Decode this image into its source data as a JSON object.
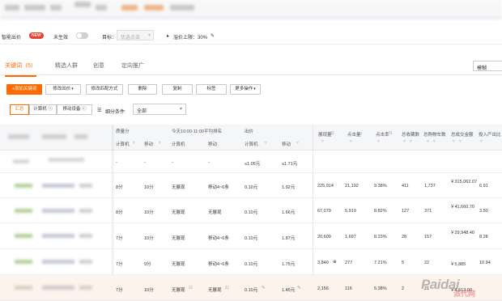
{
  "smart_row": {
    "smart_label": "智能出价",
    "new_badge": "NEW",
    "ineffective_label": "未生效",
    "target_label": "目标：",
    "target_placeholder": "优选点击",
    "ceiling_label": "溢价上限：30%",
    "pencil_icon": "✎"
  },
  "tabs": [
    {
      "label": "关键词（5）",
      "active": true
    },
    {
      "label": "精选人群",
      "active": false
    },
    {
      "label": "创意",
      "active": false
    },
    {
      "label": "定向推广",
      "active": false
    }
  ],
  "match_select": "模糊",
  "toolbar": {
    "add_keyword": "+添加关键词",
    "modify_bid": "修改出价",
    "modify_match": "修改匹配方式",
    "delete": "删除",
    "copy": "复制",
    "tag": "标签",
    "more": "更多操作"
  },
  "segments": {
    "summary": "汇总",
    "pc": "计算机",
    "mobile": "移动设备",
    "filter_label": "细分条件:",
    "filter_value": "全部"
  },
  "table": {
    "group_headers": {
      "quality": "质量分",
      "rank": "今天10:00-11:00平均排名",
      "bid": "出价",
      "impressions": "展现量",
      "clicks": "点击量",
      "ctr": "点击率",
      "total_fav": "总收藏数",
      "total_cart": "总购物车数",
      "total_trans": "总成交金额",
      "roi": "投入产出比"
    },
    "sub_headers": {
      "pc": "计算机",
      "mobile": "移动",
      "rank_pc": "计算机",
      "rank_mobile": "移动",
      "bid_pc": "计算机",
      "bid_mobile": "移动"
    },
    "rows": [
      {
        "q_pc": "-",
        "q_mob": "-",
        "r_pc": "-",
        "r_mob": "-",
        "b_pc": "≤1.05元",
        "b_mob": "≤1.71元",
        "imp": "",
        "clk": "",
        "ctr": "",
        "fav": "",
        "cart": "",
        "trans": "",
        "roi": ""
      },
      {
        "q_pc": "8分",
        "q_mob": "10分",
        "r_pc": "无展现",
        "r_mob": "移动4~6条",
        "b_pc": "0.10元",
        "b_mob": "1.92元",
        "imp": "225,914",
        "clk": "21,192",
        "ctr": "9.38%",
        "fav": "411",
        "cart": "1,737",
        "trans": "￥315,062.07",
        "roi": "6.91"
      },
      {
        "q_pc": "8分",
        "q_mob": "10分",
        "r_pc": "无展现",
        "r_mob": "无展现",
        "b_pc": "0.10元",
        "b_mob": "1.66元",
        "imp": "67,079",
        "clk": "5,919",
        "ctr": "8.82%",
        "fav": "127",
        "cart": "371",
        "trans": "￥41,660.70",
        "roi": "3.50"
      },
      {
        "q_pc": "7分",
        "q_mob": "10分",
        "r_pc": "无展现",
        "r_mob": "移动4~6条",
        "b_pc": "0.10元",
        "b_mob": "1.87元",
        "imp": "20,609",
        "clk": "1,697",
        "ctr": "8.23%",
        "fav": "28",
        "cart": "157",
        "trans": "￥29,948.40",
        "roi": "8.28"
      },
      {
        "q_pc": "7分",
        "q_mob": "9分",
        "r_pc": "无展现",
        "r_mob": "移动4~6条",
        "b_pc": "0.10元",
        "b_mob": "1.75元",
        "imp": "3,840",
        "clk": "277",
        "ctr": "7.21%",
        "fav": "5",
        "cart": "22",
        "trans": "￥5,885",
        "roi": "10.94"
      },
      {
        "q_pc": "7分",
        "q_mob": "10分",
        "r_pc": "无展现",
        "r_mob": "无展现",
        "b_pc": "0.10元",
        "b_mob": "1.45元",
        "imp": "2,156",
        "clk": "116",
        "ctr": "5.38%",
        "fav": "2",
        "cart": "21",
        "trans": "￥4,613.00",
        "roi": ""
      }
    ]
  },
  "watermark": "Paidai",
  "watermark_sub": "派代网",
  "colors": {
    "accent": "#ff6a00",
    "badge": "#e8412b"
  }
}
